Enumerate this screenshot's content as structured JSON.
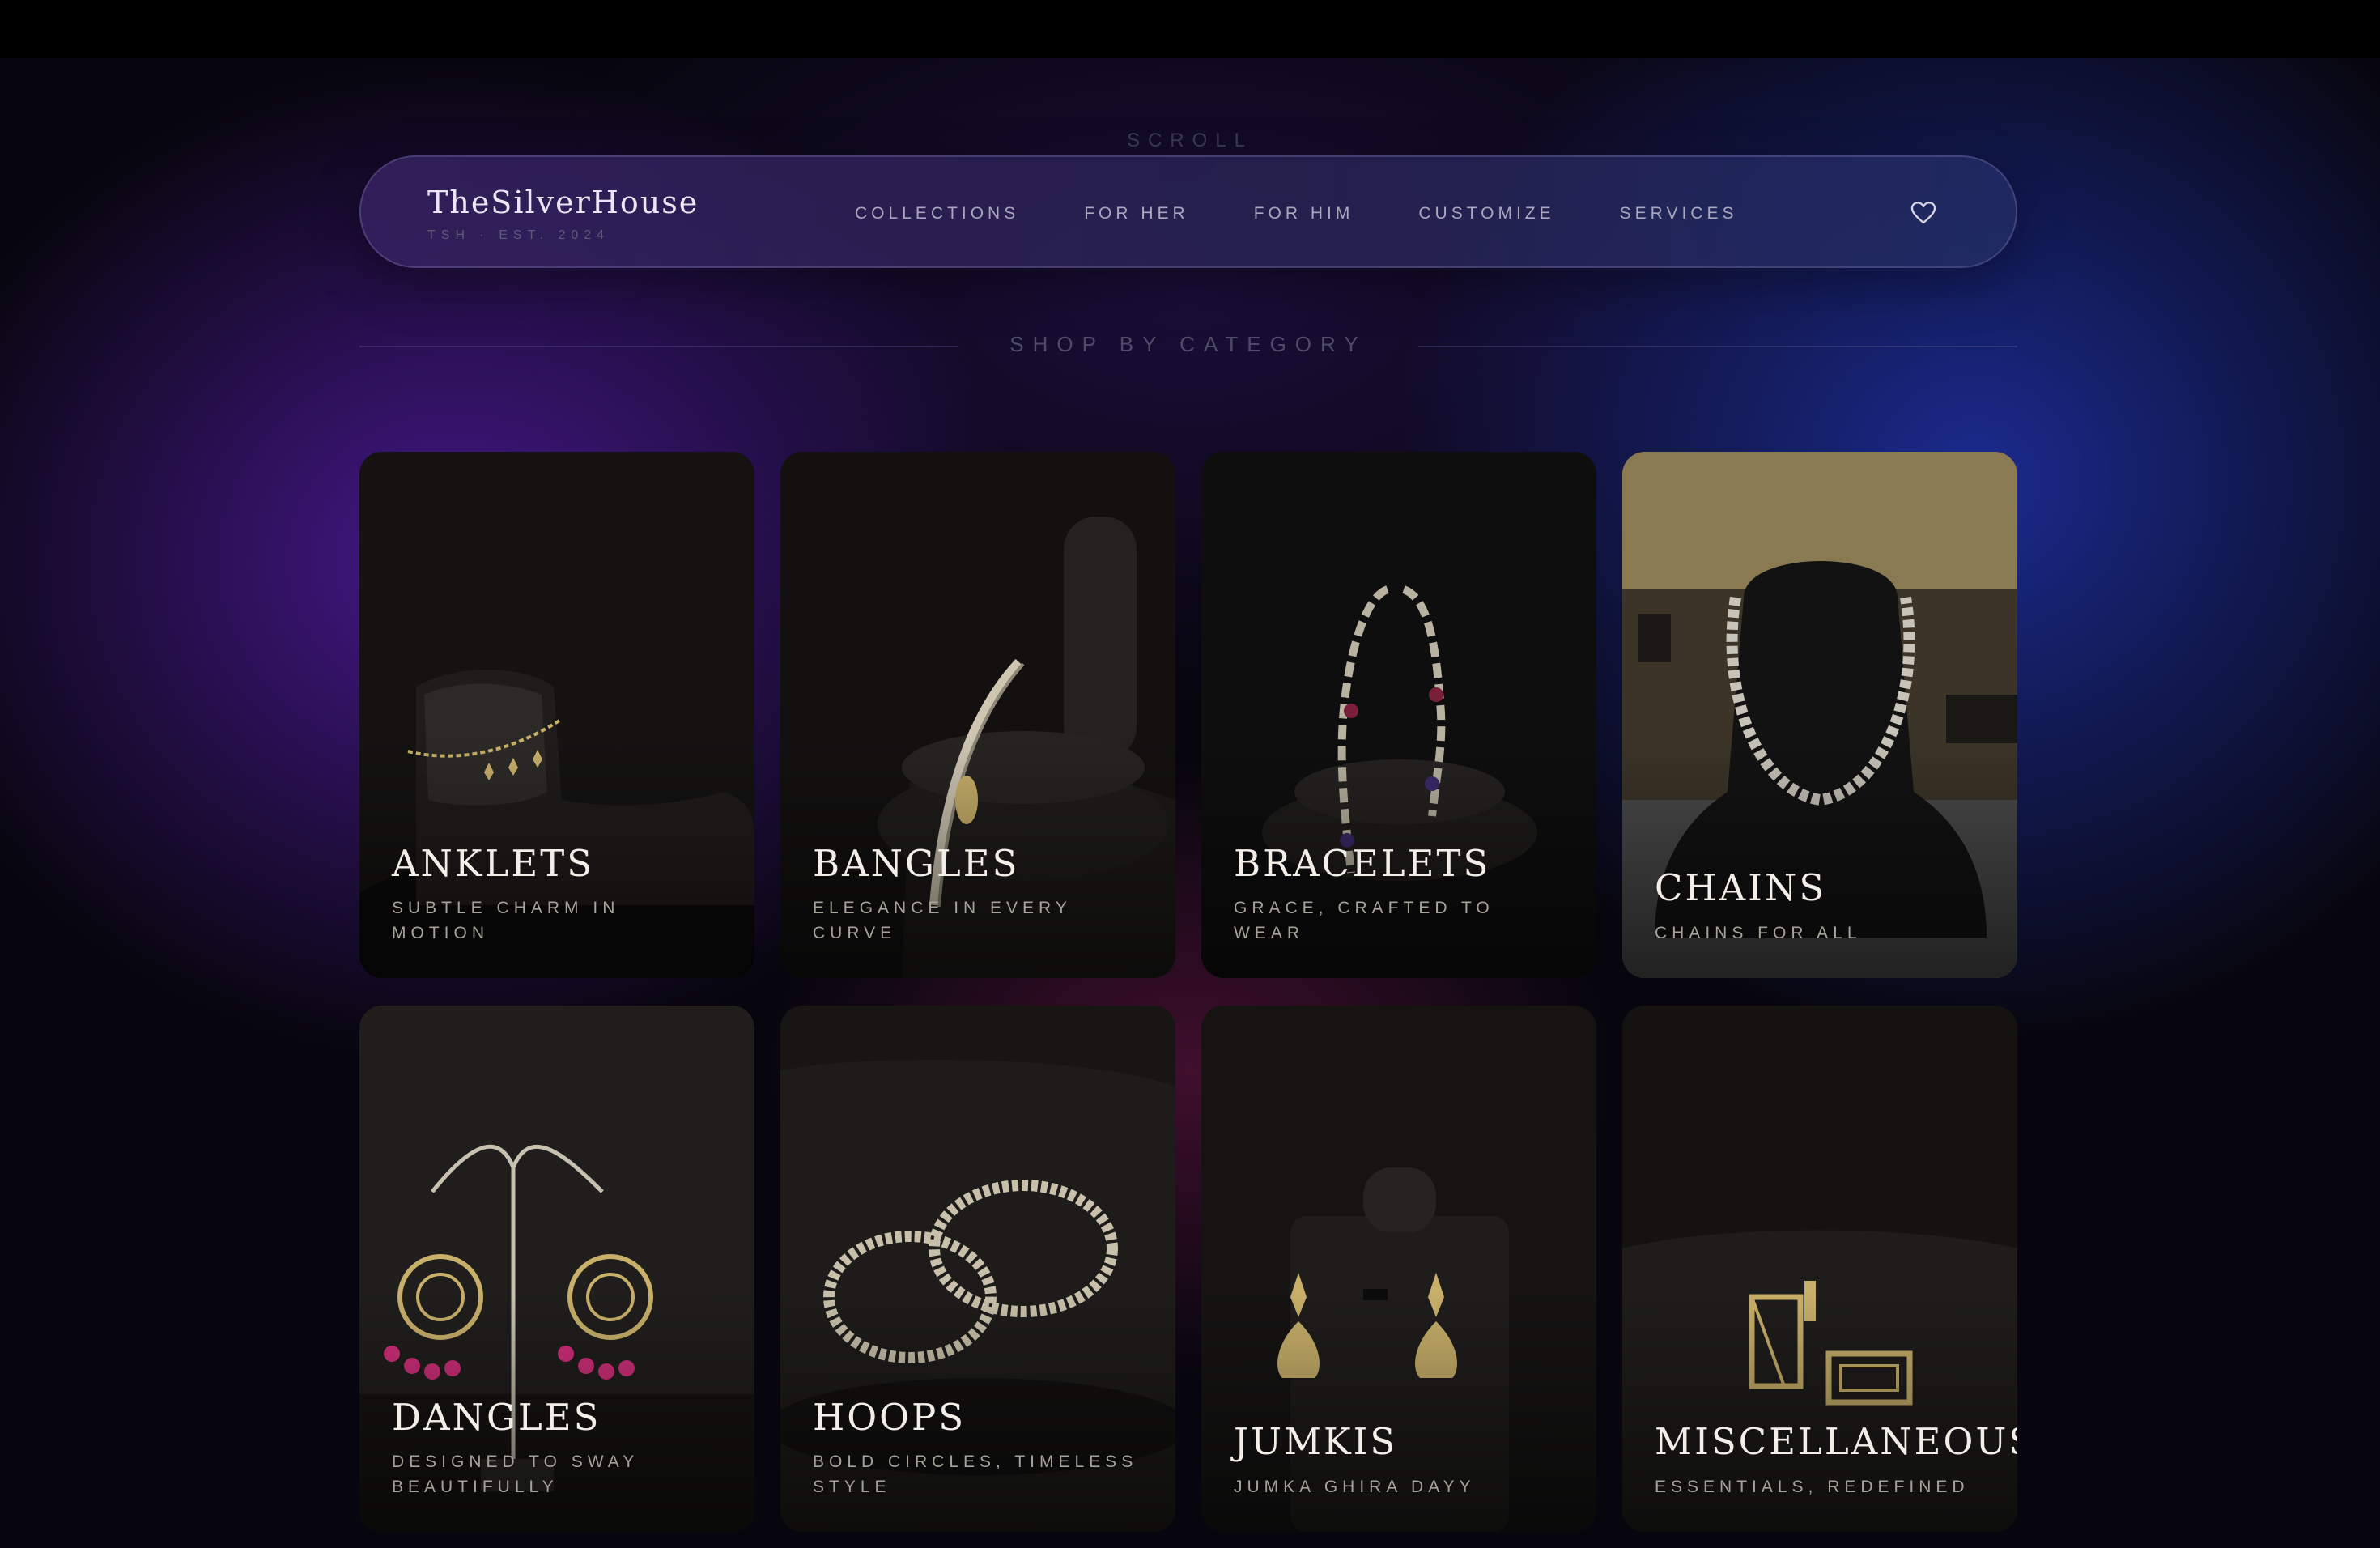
{
  "scroll_hint": "SCROLL",
  "nav": {
    "brand_name": "TheSilverHouse",
    "brand_sub": "TSH · EST. 2024",
    "links": [
      "COLLECTIONS",
      "FOR HER",
      "FOR HIM",
      "CUSTOMIZE",
      "SERVICES"
    ],
    "wishlist_icon": "heart-icon"
  },
  "section": {
    "title": "SHOP BY CATEGORY"
  },
  "categories": [
    {
      "title": "ANKLETS",
      "subtitle": "SUBTLE CHARM IN MOTION",
      "image": "anklet-photo"
    },
    {
      "title": "BANGLES",
      "subtitle": "ELEGANCE IN EVERY CURVE",
      "image": "bangle-photo"
    },
    {
      "title": "BRACELETS",
      "subtitle": "GRACE, CRAFTED TO WEAR",
      "image": "bracelet-photo"
    },
    {
      "title": "CHAINS",
      "subtitle": "CHAINS FOR ALL",
      "image": "chain-photo"
    },
    {
      "title": "DANGLES",
      "subtitle": "DESIGNED TO SWAY BEAUTIFULLY",
      "image": "dangle-earrings-photo"
    },
    {
      "title": "HOOPS",
      "subtitle": "BOLD CIRCLES, TIMELESS STYLE",
      "image": "hoop-earrings-photo"
    },
    {
      "title": "JUMKIS",
      "subtitle": "JUMKA GHIRA DAYY",
      "image": "jhumka-earrings-photo"
    },
    {
      "title": "MISCELLANEOUS",
      "subtitle": "ESSENTIALS, REDEFINED",
      "image": "cufflinks-photo"
    }
  ],
  "colors": {
    "accent_purple": "#561caa",
    "accent_blue": "#2034af",
    "gold": "#c9b06a",
    "pink_stone": "#d12f7a"
  }
}
